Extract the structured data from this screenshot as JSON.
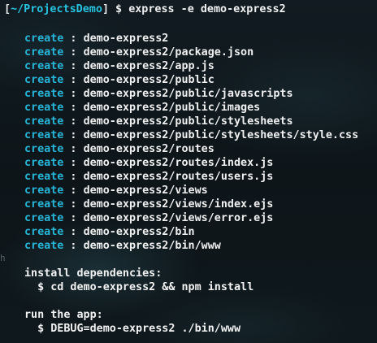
{
  "prompt": {
    "open_bracket": "[",
    "cwd": "~/ProjectsDemo",
    "close_bracket": "]",
    "symbol": " $ ",
    "command": "express -e demo-express2"
  },
  "create_keyword": "create",
  "separator": " : ",
  "created_paths": [
    "demo-express2",
    "demo-express2/package.json",
    "demo-express2/app.js",
    "demo-express2/public",
    "demo-express2/public/javascripts",
    "demo-express2/public/images",
    "demo-express2/public/stylesheets",
    "demo-express2/public/stylesheets/style.css",
    "demo-express2/routes",
    "demo-express2/routes/index.js",
    "demo-express2/routes/users.js",
    "demo-express2/views",
    "demo-express2/views/index.ejs",
    "demo-express2/views/error.ejs",
    "demo-express2/bin",
    "demo-express2/bin/www"
  ],
  "stray_glyph": "h",
  "install": {
    "heading": "install dependencies:",
    "command": "  $ cd demo-express2 && npm install"
  },
  "run": {
    "heading": "run the app:",
    "command": "  $ DEBUG=demo-express2 ./bin/www"
  },
  "colors": {
    "background": "#0f181c",
    "cwd": "#27c3e0",
    "keyword": "#27b6d8",
    "text": "#f0f0f0"
  }
}
